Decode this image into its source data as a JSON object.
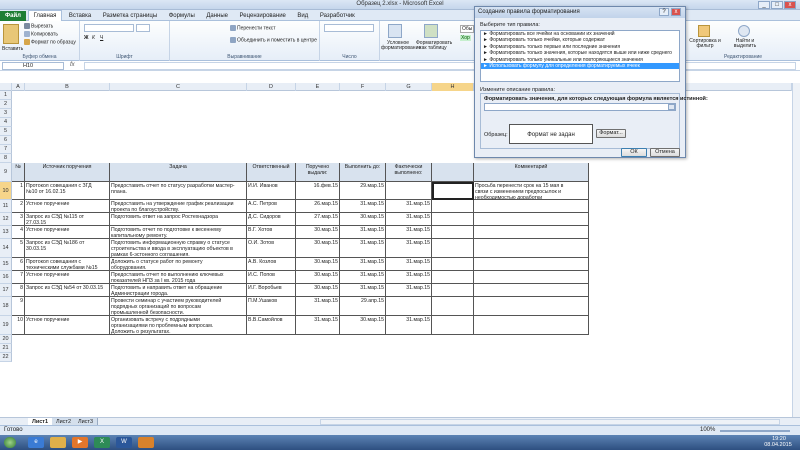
{
  "window": {
    "title": "Образец 2.xlsx - Microsoft Excel",
    "min": "_",
    "max": "□",
    "close": "x"
  },
  "tabs": [
    "Файл",
    "Главная",
    "Вставка",
    "Разметка страницы",
    "Формулы",
    "Данные",
    "Рецензирование",
    "Вид",
    "Разработчик"
  ],
  "ribbon": {
    "cut": "Вырезать",
    "copy": "Копировать",
    "format_painter": "Формат по образцу",
    "clipboard": "Буфер обмена",
    "font": "Шрифт",
    "alignment": "Выравнивание",
    "number": "Число",
    "wrap_text": "Перенести текст",
    "merge": "Объединить и поместить в центре",
    "cond_format": "Условное форматирование",
    "format_table": "Форматировать как таблицу",
    "styles_partial": "Обы",
    "styles_partial2": "Хор",
    "sort_filter": "Сортировка и фильтр",
    "find_select": "Найти и выделить",
    "editing": "Редактирование",
    "paste": "Вставить"
  },
  "formula_bar": {
    "name_box": "H10",
    "fx": "fx",
    "value": ""
  },
  "columns": [
    "A",
    "B",
    "C",
    "D",
    "E",
    "F",
    "G",
    "H",
    "I"
  ],
  "selected_column": "H",
  "rows": [
    "1",
    "2",
    "3",
    "4",
    "5",
    "6",
    "7",
    "8",
    "9",
    "10",
    "11",
    "12",
    "13",
    "14",
    "15",
    "16",
    "17",
    "18",
    "19",
    "20",
    "21",
    "22"
  ],
  "selected_row": "10",
  "table_header": {
    "num": "№",
    "source": "Источник поручения",
    "task": "Задача",
    "responsible": "Ответственный",
    "received": "Поручено\nвыдали:",
    "due": "Выполнить до:",
    "actual": "Фактически\nвыполнено:",
    "comment": "Комментарий"
  },
  "table_rows": [
    {
      "row": "10",
      "num": "1",
      "source": "Протокол совещания с ЗГД\n№10 от 16.02.15",
      "task": "Предоставить отчет по статусу разработки мастер-\nплана.",
      "resp": "И.И. Иванов",
      "recv": "16.фев.15",
      "due": "29.мар.15",
      "act": "",
      "comment": "Просьба перенести срок на 15 мая в\nсвязи с изменением предпосылок и\nнеобходимостью доработки"
    },
    {
      "row": "11",
      "num": "2",
      "source": "Устное поручение",
      "task": "Предоставить на утверждение график реализации\nпроекта по благоустройству.",
      "resp": "А.С. Петров",
      "recv": "26.мар.15",
      "due": "31.мар.15",
      "act": "31.мар.15",
      "comment": ""
    },
    {
      "row": "12",
      "num": "3",
      "source": "Запрос из СЭД №115 от\n27.03.15",
      "task": "Подготовить ответ на запрос Ростехнадзора",
      "resp": "Д.С. Сидоров",
      "recv": "27.мар.15",
      "due": "30.мар.15",
      "act": "31.мар.15",
      "comment": ""
    },
    {
      "row": "13",
      "num": "4",
      "source": "Устное поручение",
      "task": "Подготовить отчет по подготовке к весеннему\nкапитальному ремонту.",
      "resp": "В.Г. Хотов",
      "recv": "30.мар.15",
      "due": "31.мар.15",
      "act": "31.мар.15",
      "comment": ""
    },
    {
      "row": "14",
      "num": "5",
      "source": "Запрос из СЭД №186 от\n30.03.15",
      "task": "Подготовить информационную справку о статусе\nстроительства и ввода в эксплуатацию объектов в\nрамках 6-эстонного соглашения.",
      "resp": "О.И. Зотов",
      "recv": "30.мар.15",
      "due": "31.мар.15",
      "act": "31.мар.15",
      "comment": ""
    },
    {
      "row": "15",
      "num": "6",
      "source": "Протокол совещания с\nтехническими службами №15",
      "task": "Доложить о статусе работ по ремонту\nоборудования.",
      "resp": "А.В. Козлов",
      "recv": "30.мар.15",
      "due": "31.мар.15",
      "act": "31.мар.15",
      "comment": ""
    },
    {
      "row": "16",
      "num": "7",
      "source": "Устное поручение",
      "task": "Предоставить отчет по выполнению ключевых\nпоказателей НПЗ за I кв. 2015 года",
      "resp": "И.С. Попов",
      "recv": "30.мар.15",
      "due": "31.мар.15",
      "act": "31.мар.15",
      "comment": ""
    },
    {
      "row": "17",
      "num": "8",
      "source": "Запрос из СЭД №54 от 30.03.15",
      "task": "Подготовить и направить ответ на обращение\nАдминистрации города.",
      "resp": "И.Г. Воробьев",
      "recv": "30.мар.15",
      "due": "31.мар.15",
      "act": "31.мар.15",
      "comment": ""
    },
    {
      "row": "18",
      "num": "9",
      "source": "",
      "task": "Провести семинар с участием руководителей\nподрядных организаций по вопросам\nпромышленной безопасности.",
      "resp": "П.М.Ушаков",
      "recv": "31.мар.15",
      "due": "29.апр.15",
      "act": "",
      "comment": ""
    },
    {
      "row": "19",
      "num": "10",
      "source": "Устное поручение",
      "task": "Организовать встречу с подрядными\nорганизациями по проблемным вопросам.\nДоложить о результатах.",
      "resp": "В.В.Самойлов",
      "recv": "31.мар.15",
      "due": "30.мар.15",
      "act": "31.мар.15",
      "comment": ""
    }
  ],
  "dialog": {
    "title": "Создание правила форматирования",
    "help": "?",
    "close": "x",
    "select_type_label": "Выберите тип правила:",
    "rules": [
      "► Форматировать все ячейки на основании их значений",
      "► Форматировать только ячейки, которые содержат",
      "► Форматировать только первые или последние значения",
      "► Форматировать только значения, которые находятся выше или ниже среднего",
      "► Форматировать только уникальные или повторяющиеся значения",
      "► Использовать формулу для определения форматируемых ячеек"
    ],
    "selected_rule": 5,
    "edit_desc_label": "Измените описание правила:",
    "formula_label": "Форматировать значения, для которых следующая формула является истинной:",
    "formula_value": "",
    "preview_label": "Образец:",
    "preview_text": "Формат не задан",
    "format_button": "Формат...",
    "ok": "ОК",
    "cancel": "Отмена"
  },
  "sheet_tabs": [
    "Лист1",
    "Лист2",
    "Лист3"
  ],
  "active_sheet": "Лист1",
  "status": {
    "ready": "Готово",
    "zoom": "100%"
  },
  "clock": {
    "time": "19:20",
    "date": "08.04.2015"
  },
  "taskbar": [
    "start",
    "ie",
    "explorer",
    "media",
    "excel",
    "word",
    "app"
  ]
}
